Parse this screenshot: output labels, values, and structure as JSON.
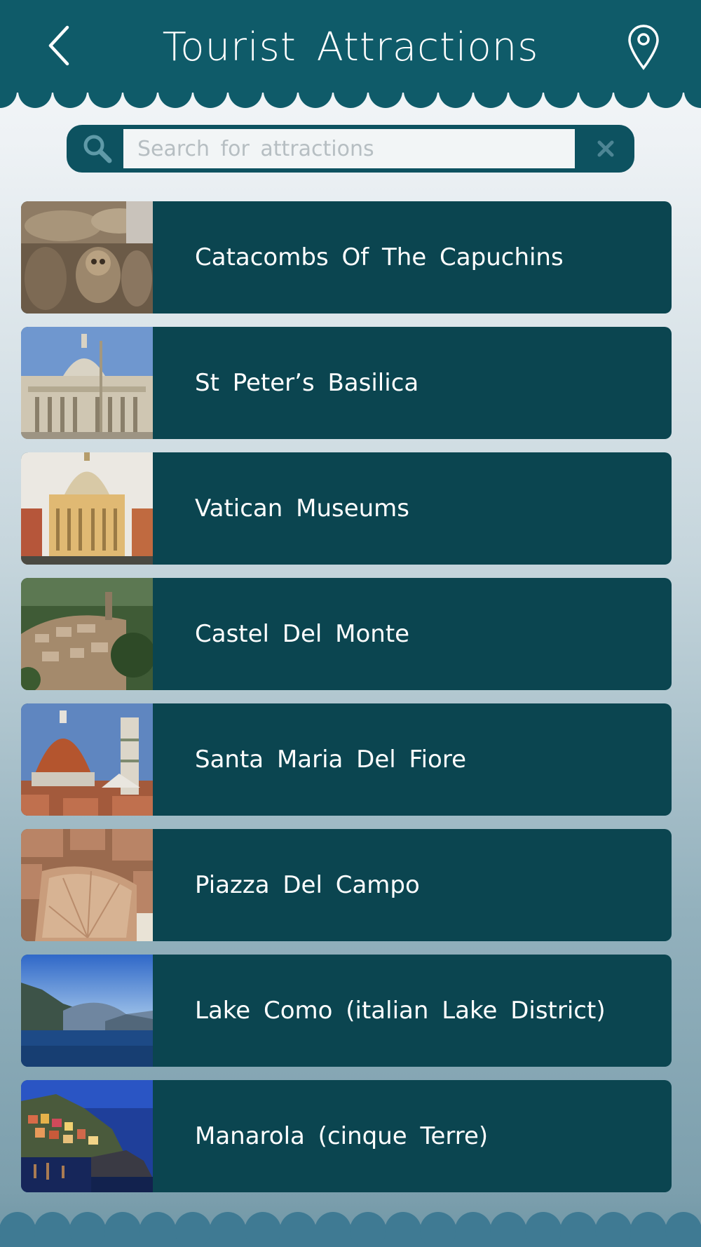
{
  "header": {
    "title": "Tourist Attractions",
    "back_icon": "chevron-left-icon",
    "map_icon": "map-pin-icon",
    "color": "#0f5b69"
  },
  "search": {
    "placeholder": "Search for attractions",
    "value": "",
    "search_icon": "search-icon",
    "clear_icon": "close-icon"
  },
  "attractions": [
    {
      "name": "Catacombs Of The Capuchins"
    },
    {
      "name": "St Peter’s Basilica"
    },
    {
      "name": "Vatican Museums"
    },
    {
      "name": "Castel Del Monte"
    },
    {
      "name": "Santa Maria Del Fiore"
    },
    {
      "name": "Piazza Del Campo"
    },
    {
      "name": "Lake Como (italian Lake District)"
    },
    {
      "name": "Manarola (cinque Terre)"
    }
  ],
  "colors": {
    "row_bg": "#0b4550",
    "footer": "#3f7a93"
  }
}
